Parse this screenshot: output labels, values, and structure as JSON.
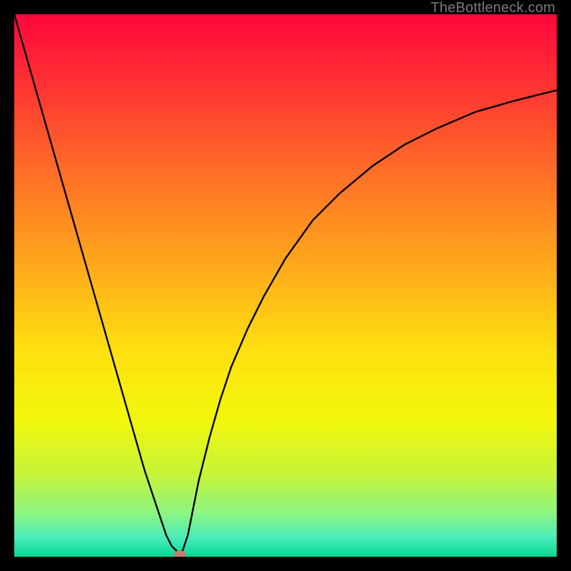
{
  "watermark": "TheBottleneck.com",
  "chart_data": {
    "type": "line",
    "title": "",
    "xlabel": "",
    "ylabel": "",
    "xlim": [
      0,
      100
    ],
    "ylim": [
      0,
      100
    ],
    "background_gradient": {
      "stops": [
        {
          "offset": 0.0,
          "color": "#ff063c"
        },
        {
          "offset": 0.12,
          "color": "#ff2f34"
        },
        {
          "offset": 0.28,
          "color": "#ff6a28"
        },
        {
          "offset": 0.45,
          "color": "#ffa41c"
        },
        {
          "offset": 0.62,
          "color": "#ffe010"
        },
        {
          "offset": 0.75,
          "color": "#f2f70c"
        },
        {
          "offset": 0.85,
          "color": "#c4f43a"
        },
        {
          "offset": 0.92,
          "color": "#8df583"
        },
        {
          "offset": 0.965,
          "color": "#49ecbb"
        },
        {
          "offset": 1.0,
          "color": "#06d793"
        }
      ]
    },
    "series": [
      {
        "name": "bottleneck-curve",
        "x": [
          0,
          2,
          4,
          6,
          8,
          10,
          12,
          14,
          16,
          18,
          20,
          22,
          24,
          26,
          28,
          29,
          30,
          30.5,
          31,
          32,
          33,
          34,
          36,
          38,
          40,
          43,
          46,
          50,
          55,
          60,
          66,
          72,
          78,
          85,
          92,
          100
        ],
        "y": [
          100,
          93,
          86,
          79,
          72,
          65,
          58,
          51,
          44,
          37,
          30,
          23,
          16,
          10,
          4,
          2,
          1,
          0.4,
          1,
          4,
          9,
          14,
          22,
          29,
          35,
          42,
          48,
          55,
          62,
          67,
          72,
          76,
          79,
          82,
          84,
          86
        ]
      }
    ],
    "marker": {
      "x": 30.5,
      "y": 0.4,
      "color": "#c97a6d",
      "rx": 8,
      "ry": 6
    }
  }
}
